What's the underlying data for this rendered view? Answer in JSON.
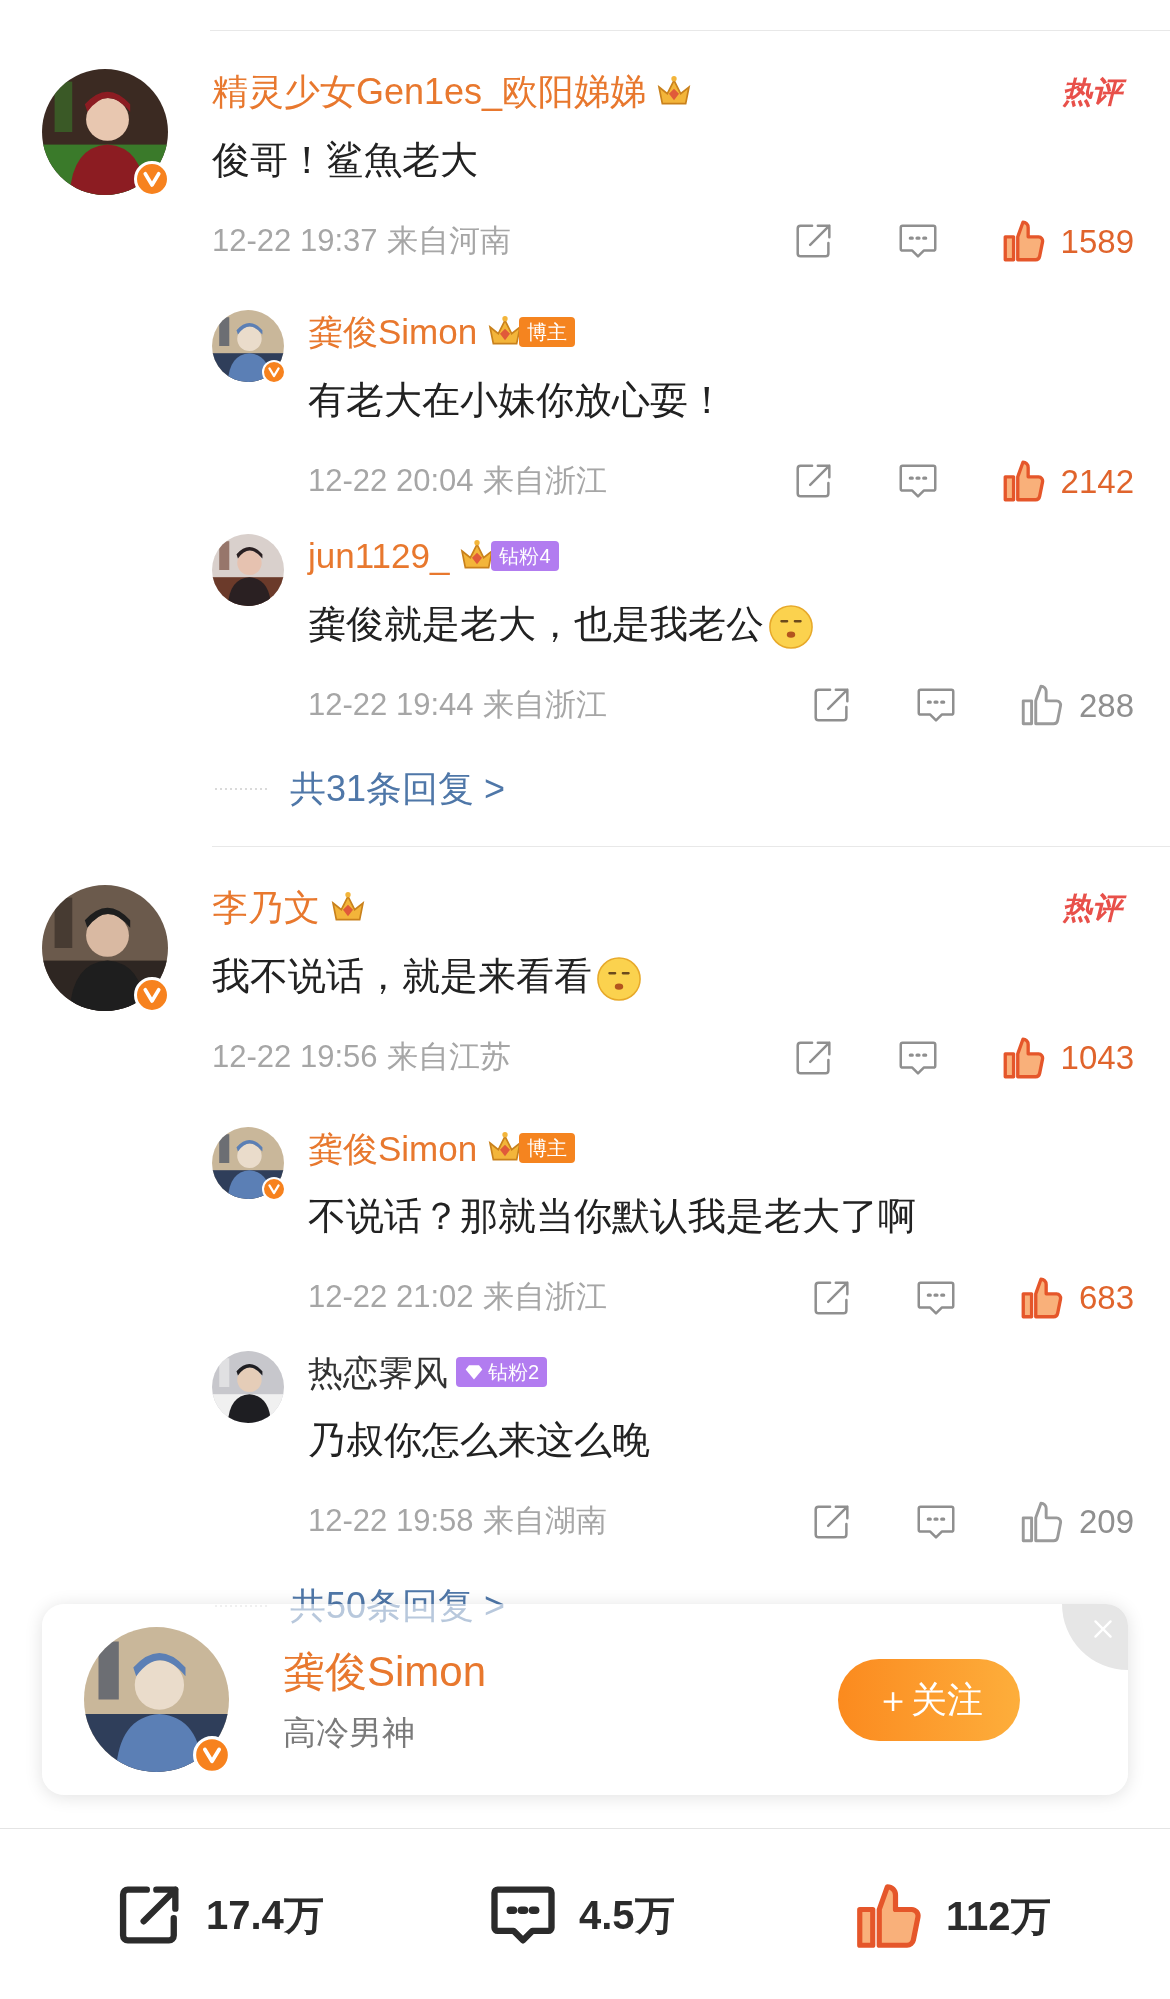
{
  "comments": [
    {
      "user": {
        "name": "精灵少女Gen1es_欧阳娣娣",
        "vip": true,
        "verified": true,
        "badges": [
          {
            "kind": "crown"
          }
        ]
      },
      "hot_label": "热评",
      "text": "俊哥！鲨魚老大",
      "emoji": false,
      "time": "12-22 19:37",
      "location": "来自河南",
      "likes": "1589",
      "liked": true,
      "replies": [
        {
          "user": {
            "name": "龚俊Simon",
            "vip": true,
            "verified": true,
            "badges": [
              {
                "kind": "crown"
              },
              {
                "kind": "tag",
                "text": "博主",
                "color": "#f5841f"
              }
            ]
          },
          "text": "有老大在小妹你放心耍！",
          "emoji": false,
          "time": "12-22 20:04",
          "location": "来自浙江",
          "likes": "2142",
          "liked": true
        },
        {
          "user": {
            "name": "jun1129_",
            "vip": true,
            "verified": false,
            "badges": [
              {
                "kind": "crown"
              },
              {
                "kind": "tag",
                "text": "钻粉4",
                "color": "#b27cf0"
              }
            ]
          },
          "text": "龚俊就是老大，也是我老公",
          "emoji": true,
          "time": "12-22 19:44",
          "location": "来自浙江",
          "likes": "288",
          "liked": false
        }
      ],
      "more_replies": "共31条回复 >"
    },
    {
      "user": {
        "name": "李乃文",
        "vip": true,
        "verified": true,
        "badges": [
          {
            "kind": "crown"
          }
        ]
      },
      "hot_label": "热评",
      "text": "我不说话，就是来看看",
      "emoji": true,
      "time": "12-22 19:56",
      "location": "来自江苏",
      "likes": "1043",
      "liked": true,
      "replies": [
        {
          "user": {
            "name": "龚俊Simon",
            "vip": true,
            "verified": true,
            "badges": [
              {
                "kind": "crown"
              },
              {
                "kind": "tag",
                "text": "博主",
                "color": "#f5841f"
              }
            ]
          },
          "text": "不说话？那就当你默认我是老大了啊",
          "emoji": false,
          "time": "12-22 21:02",
          "location": "来自浙江",
          "likes": "683",
          "liked": true
        },
        {
          "user": {
            "name": "热恋霁风",
            "vip": false,
            "verified": false,
            "badges": [
              {
                "kind": "diamond-tag",
                "text": "钻粉2",
                "color": "#b27cf0"
              }
            ]
          },
          "text": "乃叔你怎么来这么晚",
          "emoji": false,
          "time": "12-22 19:58",
          "location": "来自湖南",
          "likes": "209",
          "liked": false
        }
      ],
      "more_replies": "共50条回复 >"
    }
  ],
  "popup": {
    "name": "龚俊Simon",
    "verified": true,
    "bio": "高冷男神",
    "follow": "＋关注"
  },
  "bottom_bar": [
    {
      "kind": "share",
      "count": "17.4万"
    },
    {
      "kind": "comment",
      "count": "4.5万"
    },
    {
      "kind": "like",
      "count": "112万",
      "liked": true
    }
  ]
}
